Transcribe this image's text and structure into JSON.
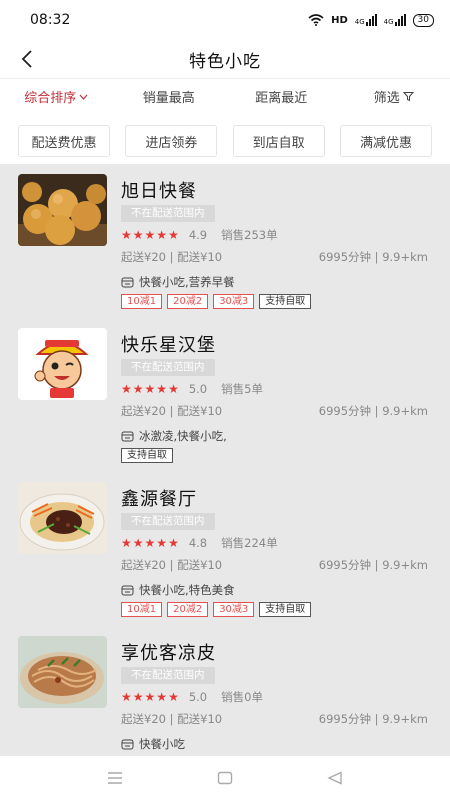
{
  "status": {
    "time": "08:32",
    "hd_label": "HD",
    "net1": "4G",
    "net2": "4G",
    "battery": "30"
  },
  "header": {
    "title": "特色小吃",
    "back_icon": "back-arrow-icon"
  },
  "sort": {
    "items": [
      {
        "label": "综合排序",
        "active": true
      },
      {
        "label": "销量最高",
        "active": false
      },
      {
        "label": "距离最近",
        "active": false
      },
      {
        "label": "筛选",
        "active": false
      }
    ]
  },
  "chips": [
    "配送费优惠",
    "进店领券",
    "到店自取",
    "满减优惠"
  ],
  "colors": {
    "accent": "#c0303a",
    "star": "#e53935",
    "list_bg": "#e8e8e8",
    "tag_red": "#e35050"
  },
  "shops": [
    {
      "name": "旭日快餐",
      "range_badge": "不在配送范围内",
      "rating_stars": 5,
      "rating": "4.9",
      "sales": "销售253单",
      "fee": "起送¥20 | 配送¥10",
      "distance": "6995分钟 | 9.9+km",
      "category": "快餐小吃,营养早餐",
      "tags": [
        {
          "text": "10减1",
          "red": true
        },
        {
          "text": "20减2",
          "red": true
        },
        {
          "text": "30减3",
          "red": true
        },
        {
          "text": "支持自取",
          "red": false
        }
      ],
      "image": "fried-sesame-balls"
    },
    {
      "name": "快乐星汉堡",
      "range_badge": "不在配送范围内",
      "rating_stars": 5,
      "rating": "5.0",
      "sales": "销售5单",
      "fee": "起送¥20 | 配送¥10",
      "distance": "6995分钟 | 9.9+km",
      "category": "冰激凌,快餐小吃,",
      "tags": [
        {
          "text": "支持自取",
          "red": false
        }
      ],
      "image": "burger-mascot-logo"
    },
    {
      "name": "鑫源餐厅",
      "range_badge": "不在配送范围内",
      "rating_stars": 5,
      "rating": "4.8",
      "sales": "销售224单",
      "fee": "起送¥20 | 配送¥10",
      "distance": "6995分钟 | 9.9+km",
      "category": "快餐小吃,特色美食",
      "tags": [
        {
          "text": "10减1",
          "red": true
        },
        {
          "text": "20减2",
          "red": true
        },
        {
          "text": "30减3",
          "red": true
        },
        {
          "text": "支持自取",
          "red": false
        }
      ],
      "image": "zhajiang-noodles"
    },
    {
      "name": "享优客凉皮",
      "range_badge": "不在配送范围内",
      "rating_stars": 5,
      "rating": "5.0",
      "sales": "销售0单",
      "fee": "起送¥20 | 配送¥10",
      "distance": "6995分钟 | 9.9+km",
      "category": "快餐小吃",
      "tags": [],
      "image": "cold-noodles"
    }
  ],
  "navbar": {
    "icons": [
      "menu-icon",
      "home-square-icon",
      "back-triangle-icon"
    ]
  }
}
